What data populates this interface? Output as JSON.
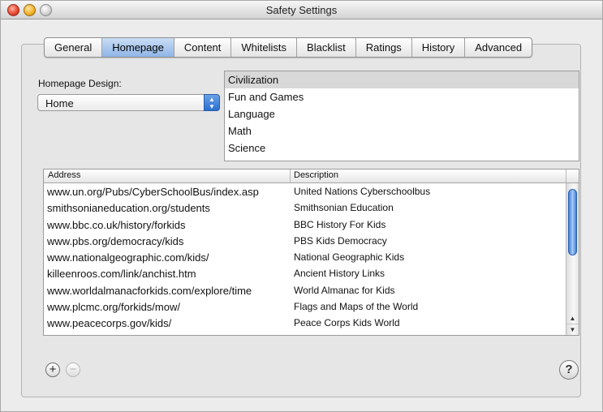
{
  "window": {
    "title": "Safety Settings"
  },
  "tabs": [
    "General",
    "Homepage",
    "Content",
    "Whitelists",
    "Blacklist",
    "Ratings",
    "History",
    "Advanced"
  ],
  "selected_tab": "Homepage",
  "homepage_design": {
    "label": "Homepage Design:",
    "value": "Home"
  },
  "categories": [
    "Civilization",
    "Fun and Games",
    "Language",
    "Math",
    "Science"
  ],
  "selected_category": "Civilization",
  "table": {
    "columns": {
      "address": "Address",
      "description": "Description"
    },
    "rows": [
      {
        "address": "www.un.org/Pubs/CyberSchoolBus/index.asp",
        "description": "United Nations Cyberschoolbus"
      },
      {
        "address": "smithsonianeducation.org/students",
        "description": "Smithsonian Education"
      },
      {
        "address": "www.bbc.co.uk/history/forkids",
        "description": "BBC History For Kids"
      },
      {
        "address": "www.pbs.org/democracy/kids",
        "description": "PBS Kids Democracy"
      },
      {
        "address": "www.nationalgeographic.com/kids/",
        "description": "National Geographic Kids"
      },
      {
        "address": "killeenroos.com/link/anchist.htm",
        "description": "Ancient History Links"
      },
      {
        "address": "www.worldalmanacforkids.com/explore/time",
        "description": "World Almanac for Kids"
      },
      {
        "address": "www.plcmc.org/forkids/mow/",
        "description": "Flags and Maps of the World"
      },
      {
        "address": "www.peacecorps.gov/kids/",
        "description": "Peace Corps Kids World"
      }
    ]
  },
  "buttons": {
    "add": "+",
    "remove": "−",
    "help": "?"
  },
  "icons": {
    "close": "close-icon",
    "minimize": "minimize-icon",
    "zoom": "zoom-icon",
    "popup_arrows": "up-down-arrows-icon",
    "scroll_up": "scroll-up-arrow-icon",
    "scroll_down": "scroll-down-arrow-icon"
  },
  "colors": {
    "selected_tab": "#8fb5e6",
    "scroll_thumb": "#3f7ed8",
    "selected_row": "#d8d8d8"
  }
}
